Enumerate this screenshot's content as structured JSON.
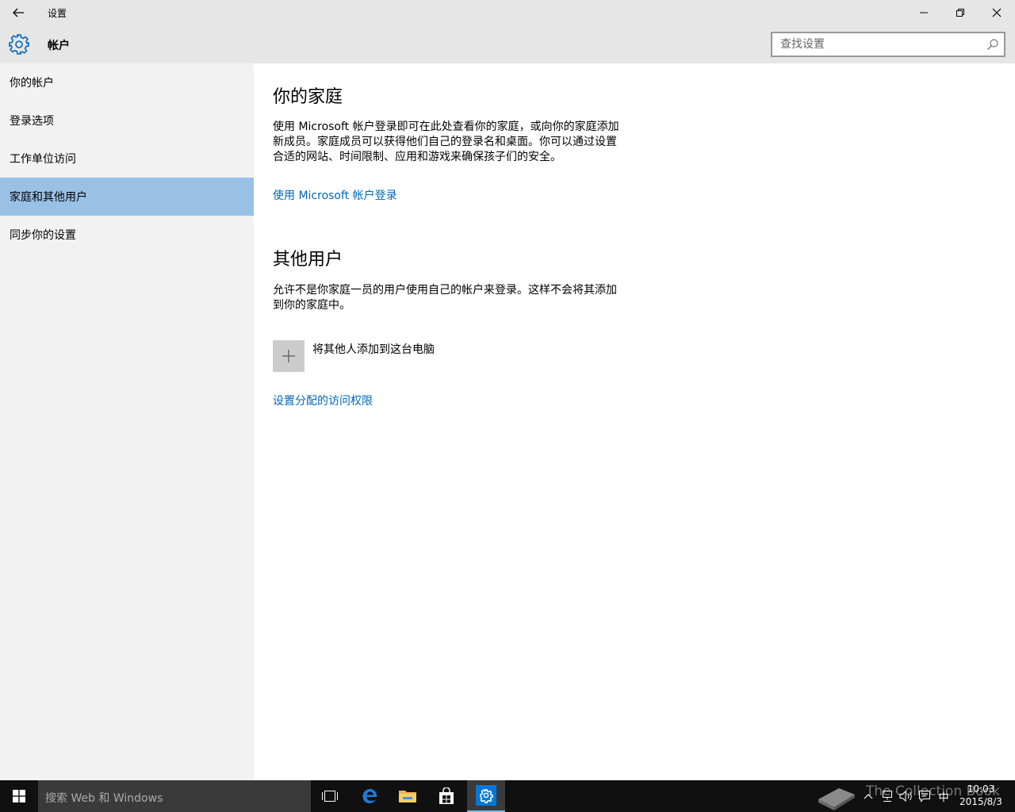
{
  "window": {
    "title": "设置",
    "back_icon": "back-arrow-icon",
    "minimize_icon": "minimize-icon",
    "restore_icon": "restore-icon",
    "close_icon": "close-icon"
  },
  "header": {
    "icon": "gear-icon",
    "title": "帐户",
    "search_placeholder": "查找设置",
    "accent_color": "#0067b8"
  },
  "sidebar": {
    "items": [
      {
        "label": "你的帐户",
        "selected": false
      },
      {
        "label": "登录选项",
        "selected": false
      },
      {
        "label": "工作单位访问",
        "selected": false
      },
      {
        "label": "家庭和其他用户",
        "selected": true
      },
      {
        "label": "同步你的设置",
        "selected": false
      }
    ],
    "selected_color": "#99c1e6"
  },
  "main": {
    "family": {
      "title": "你的家庭",
      "description": "使用 Microsoft 帐户登录即可在此处查看你的家庭，或向你的家庭添加新成员。家庭成员可以获得他们自己的登录名和桌面。你可以通过设置合适的网站、时间限制、应用和游戏来确保孩子们的安全。",
      "link": "使用 Microsoft 帐户登录"
    },
    "other_users": {
      "title": "其他用户",
      "description": "允许不是你家庭一员的用户使用自己的帐户来登录。这样不会将其添加到你的家庭中。",
      "add_label": "将其他人添加到这台电脑",
      "add_icon": "plus-icon",
      "link": "设置分配的访问权限"
    }
  },
  "taskbar": {
    "start_icon": "windows-logo-icon",
    "search_text": "搜索 Web 和 Windows",
    "apps": [
      "task-view-icon",
      "edge-icon",
      "file-explorer-icon",
      "store-icon",
      "settings-icon"
    ],
    "watermark": "The Collection Book",
    "tray_icons": [
      "chevron-up-icon",
      "network-icon",
      "volume-icon",
      "action-center-icon"
    ],
    "ime": "中",
    "time": "10:03",
    "date": "2015/8/3"
  }
}
